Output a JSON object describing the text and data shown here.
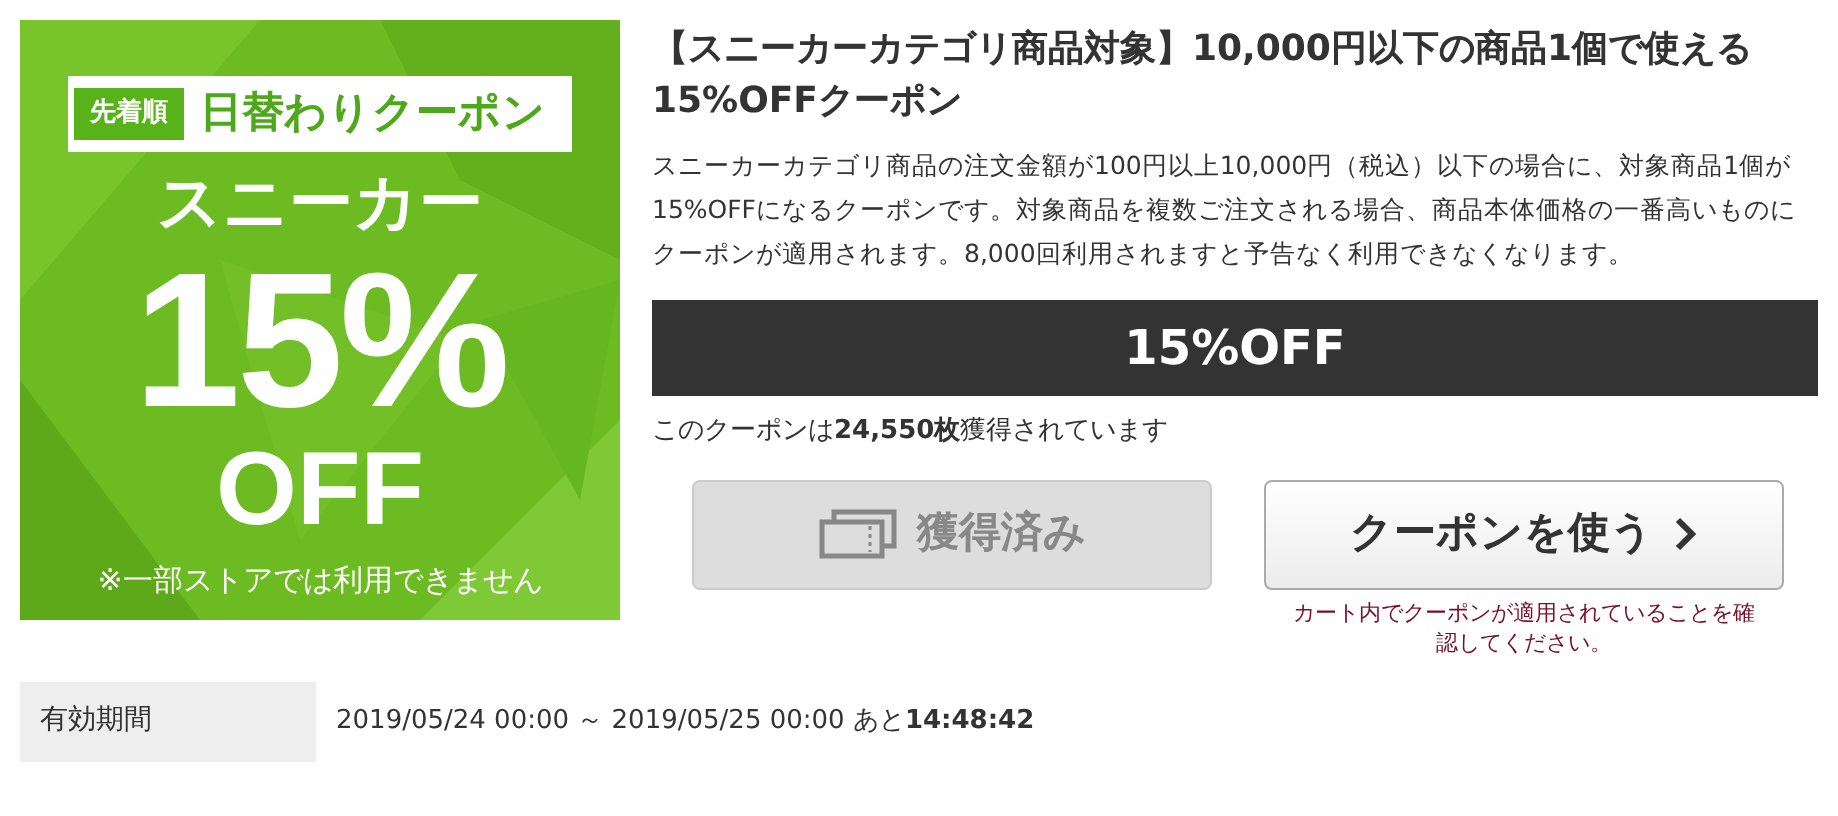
{
  "banner": {
    "tag": "先着順",
    "heading": "日替わりクーポン",
    "category": "スニーカー",
    "percent": "15%",
    "off": "OFF",
    "note": "※一部ストアでは利用できません"
  },
  "title": "【スニーカーカテゴリ商品対象】10,000円以下の商品1個で使える15%OFFクーポン",
  "description": "スニーカーカテゴリ商品の注文金額が100円以上10,000円（税込）以下の場合に、対象商品1個が15%OFFになるクーポンです。対象商品を複数ご注文される場合、商品本体価格の一番高いものにクーポンが適用されます。8,000回利用されますと予告なく利用できなくなります。",
  "discount": "15%OFF",
  "acquired_count": "このクーポンは**24,550枚**獲得されています",
  "buttons": [
    {
      "kind": "acquired",
      "label": "獲得済み",
      "disabled": true
    },
    {
      "kind": "use",
      "label": "クーポンを使う",
      "disabled": false
    }
  ],
  "use_note": "カート内でクーポンが適用されていることを確認してください。",
  "period": {
    "label": "有効期間",
    "value": "2019/05/24 00:00 ～ 2019/05/25 00:00 あと**14:48:42**"
  }
}
